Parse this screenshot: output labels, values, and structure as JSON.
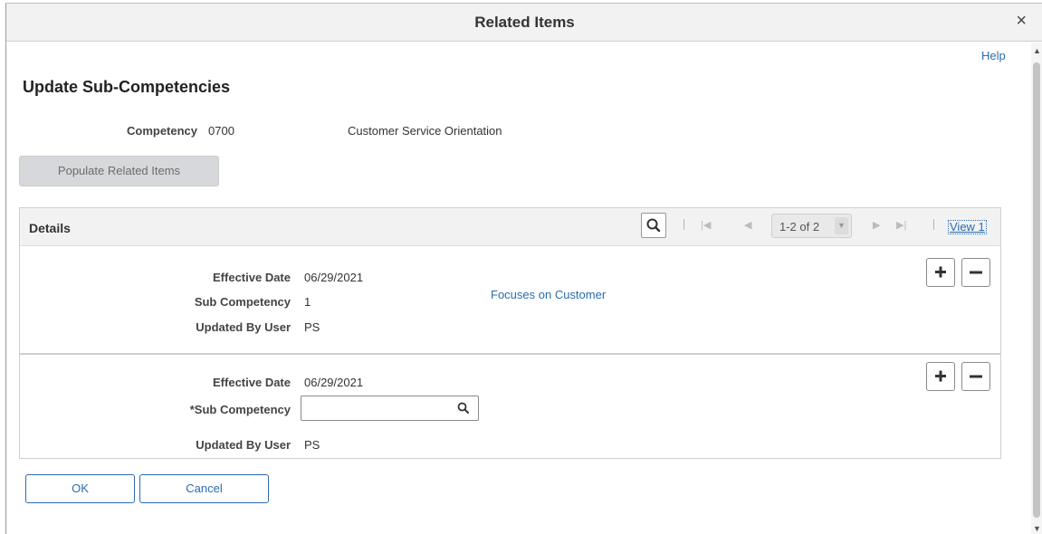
{
  "modal": {
    "title": "Related Items",
    "close_label": "×"
  },
  "help_label": "Help",
  "page_title": "Update Sub-Competencies",
  "competency": {
    "label": "Competency",
    "code": "0700",
    "description": "Customer Service Orientation"
  },
  "populate_button": "Populate Related Items",
  "grid": {
    "title": "Details",
    "pagination": "1-2 of 2",
    "view_label": "View 1",
    "rows": [
      {
        "effective_date_label": "Effective Date",
        "effective_date": "06/29/2021",
        "sub_competency_label": "Sub Competency",
        "sub_competency": "1",
        "sub_competency_description": "Focuses on Customer",
        "updated_by_label": "Updated By User",
        "updated_by": "PS"
      },
      {
        "effective_date_label": "Effective Date",
        "effective_date": "06/29/2021",
        "sub_competency_label": "*Sub Competency",
        "sub_competency_value": "",
        "updated_by_label": "Updated By User",
        "updated_by": "PS"
      }
    ]
  },
  "buttons": {
    "ok": "OK",
    "cancel": "Cancel"
  },
  "colors": {
    "link": "#2b6cb0",
    "header_bg": "#f2f2f2",
    "disabled_button_bg": "#d6d8db"
  },
  "icons": [
    "close-icon",
    "search-icon",
    "first-page-icon",
    "previous-page-icon",
    "dropdown-arrow-icon",
    "next-page-icon",
    "last-page-icon",
    "plus-icon",
    "minus-icon"
  ]
}
